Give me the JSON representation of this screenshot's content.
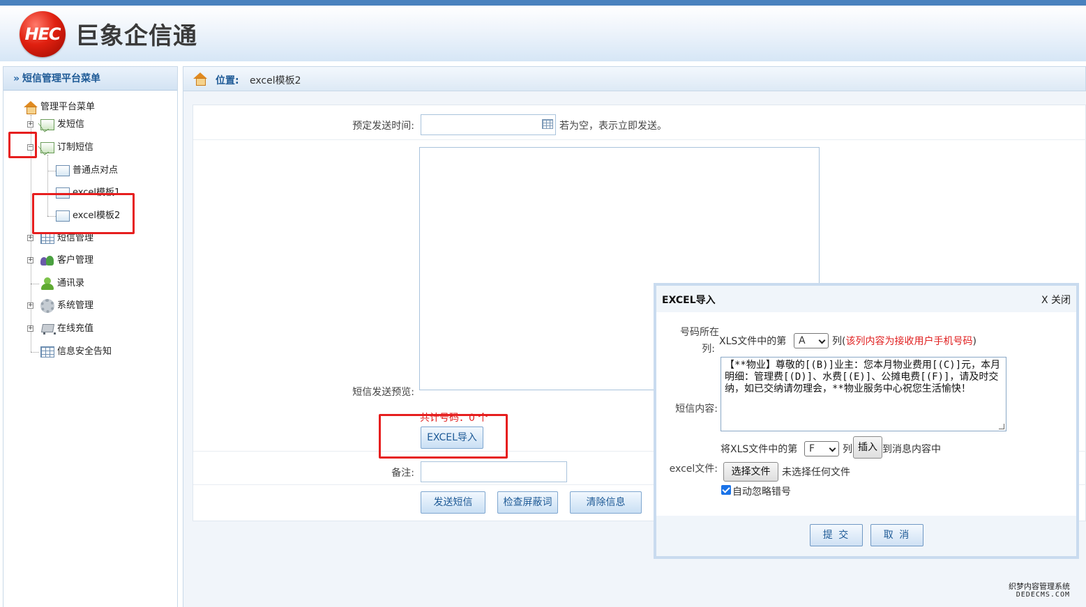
{
  "header": {
    "logo_text": "HEC",
    "title": "巨象企信通"
  },
  "sidebar": {
    "heading": "短信管理平台菜单",
    "root": "管理平台菜单",
    "items": [
      {
        "label": "发短信",
        "icon": "mail-icon"
      },
      {
        "label": "订制短信",
        "icon": "mail-icon"
      },
      {
        "label": "普通点对点",
        "icon": "mail-send-icon"
      },
      {
        "label": "excel模板1",
        "icon": "mail-send-icon"
      },
      {
        "label": "excel模板2",
        "icon": "mail-send-icon"
      },
      {
        "label": "短信管理",
        "icon": "grid-icon"
      },
      {
        "label": "客户管理",
        "icon": "users-icon"
      },
      {
        "label": "通讯录",
        "icon": "user-icon"
      },
      {
        "label": "系统管理",
        "icon": "gear-icon"
      },
      {
        "label": "在线充值",
        "icon": "cart-icon"
      },
      {
        "label": "信息安全告知",
        "icon": "grid-icon"
      }
    ]
  },
  "breadcrumb": {
    "label": "位置:",
    "value": "excel模板2"
  },
  "form": {
    "schedule_label": "预定发送时间:",
    "schedule_value": "",
    "schedule_hint": "若为空，表示立即发送。",
    "preview_label": "短信发送预览:",
    "count_text": "共计号码：0 个",
    "excel_import_button": "EXCEL导入",
    "note_label": "备注:",
    "note_value": "",
    "send_button": "发送短信",
    "check_button": "检查屏蔽词",
    "clear_button": "清除信息"
  },
  "dialog": {
    "title": "EXCEL导入",
    "close": "X 关闭",
    "phone_col_label_1": "号码所在",
    "phone_col_label_2": "列:",
    "xls_prefix": "XLS文件中的第",
    "phone_col_value": "A",
    "col_suffix": "列(",
    "phone_col_note": "该列内容为接收用户手机号码",
    "col_suffix_close": ")",
    "content_label": "短信内容:",
    "content_value": "【**物业】尊敬的[(B)]业主：您本月物业费用[(C)]元，本月明细：管理费[(D)]、水费[(E)]、公摊电费[(F)]，请及时交纳，如已交纳请勿理会，**物业服务中心祝您生活愉快！",
    "insert_prefix": "将XLS文件中的第",
    "insert_col_value": "F",
    "insert_col_suffix": "列",
    "insert_button": "插入",
    "insert_suffix": "到消息内容中",
    "file_label": "excel文件:",
    "choose_file_button": "选择文件",
    "no_file_text": "未选择任何文件",
    "auto_skip_label": "自动忽略错号",
    "auto_skip_checked": true,
    "submit_button": "提 交",
    "cancel_button": "取 消"
  },
  "watermark": {
    "line1": "织梦内容管理系统",
    "line2": "DEDECMS.COM"
  },
  "colors": {
    "accent": "#1e5a96",
    "highlight_red": "#e61e1e",
    "warning_red": "#e02020"
  }
}
